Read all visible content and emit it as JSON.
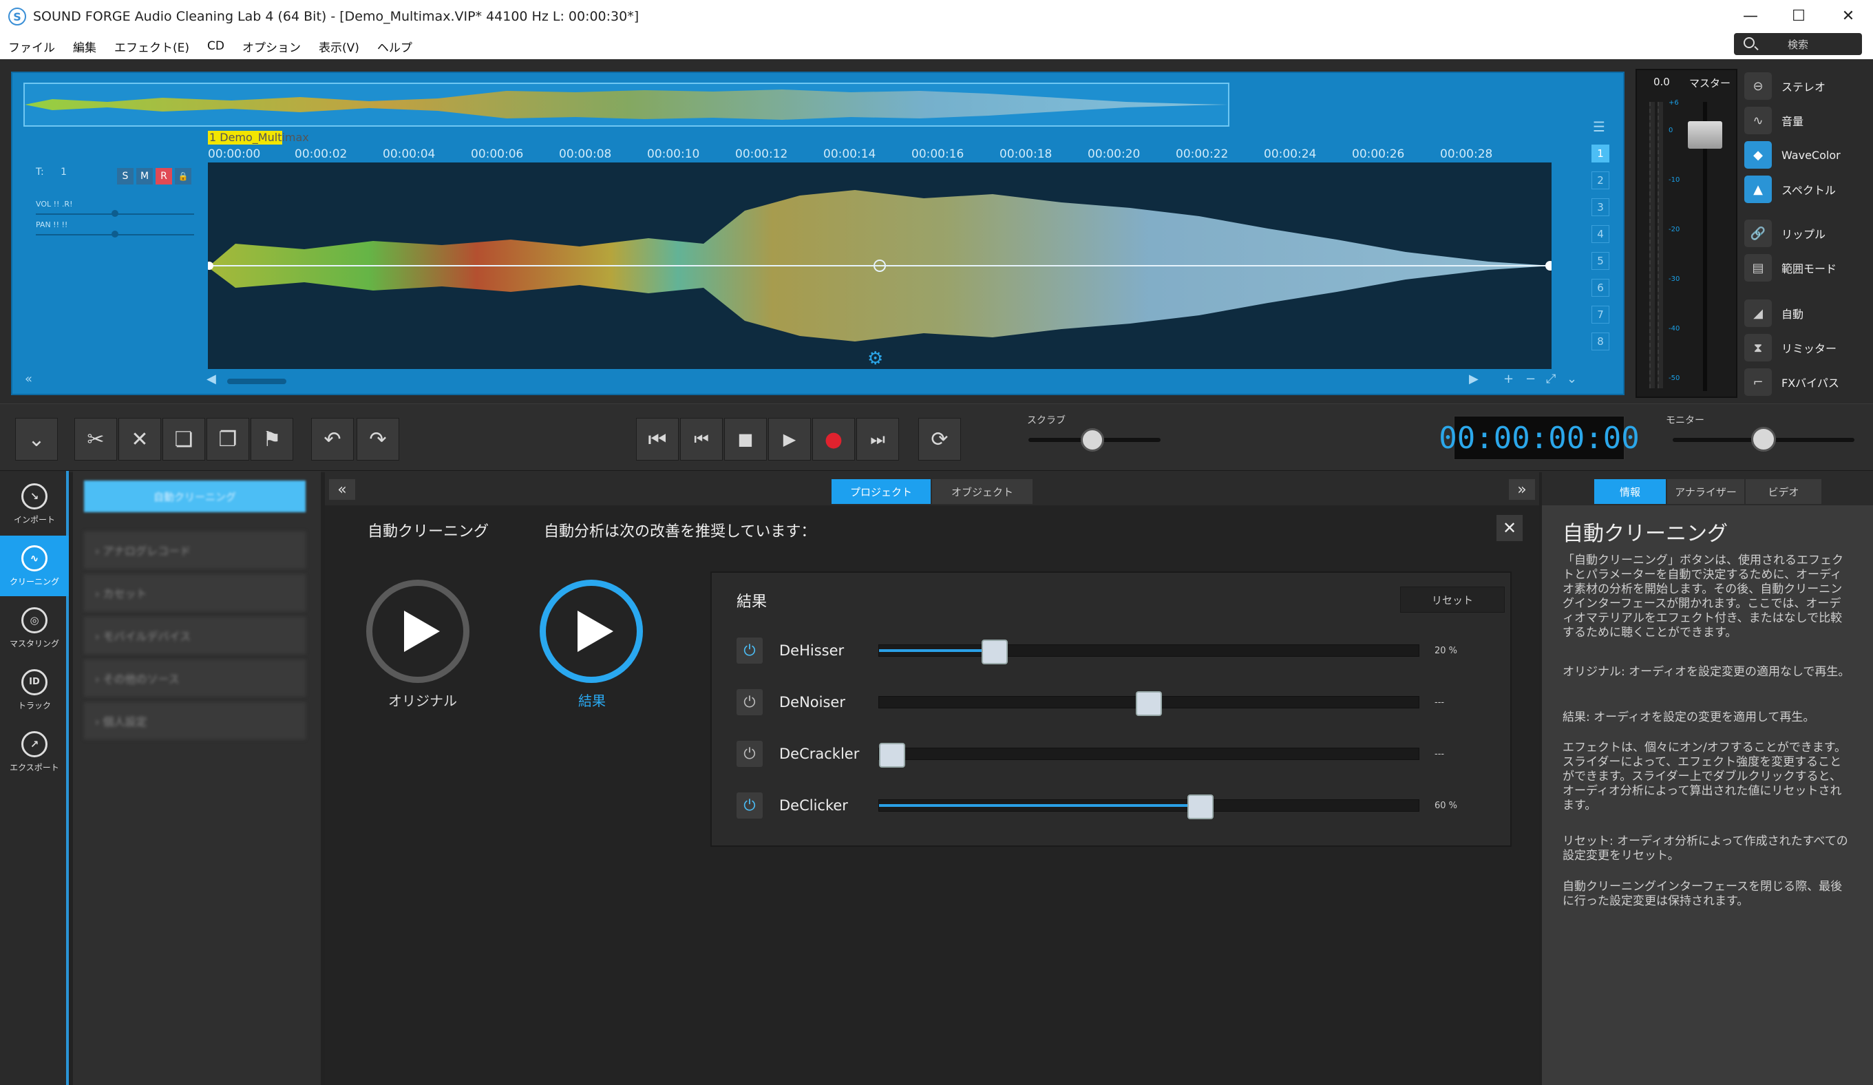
{
  "window": {
    "app_icon": "S",
    "title": "SOUND FORGE Audio Cleaning Lab 4 (64 Bit) - [Demo_Multimax.VIP*   44100 Hz L: 00:00:30*]",
    "minimize": "—",
    "maximize": "☐",
    "close": "✕"
  },
  "menu": [
    "ファイル",
    "編集",
    "エフェクト(E)",
    "CD",
    "オプション",
    "表示(V)",
    "ヘルプ"
  ],
  "search": {
    "placeholder": "検索"
  },
  "track": {
    "clip_label": "1 Demo_Multimax",
    "t_label": "T:",
    "t_value": "1",
    "buttons": [
      "S",
      "M",
      "R",
      "🔒"
    ],
    "vol_label": "VOL !!  .R!",
    "pan_label": "PAN !!  !!",
    "numbers": [
      "1",
      "2",
      "3",
      "4",
      "5",
      "6",
      "7",
      "8"
    ],
    "active_number": "1"
  },
  "ruler": [
    "00:00:00",
    "00:00:02",
    "00:00:04",
    "00:00:06",
    "00:00:08",
    "00:00:10",
    "00:00:12",
    "00:00:14",
    "00:00:16",
    "00:00:18",
    "00:00:20",
    "00:00:22",
    "00:00:24",
    "00:00:26",
    "00:00:28"
  ],
  "master": {
    "value": "0.0",
    "label": "マスター",
    "scale": [
      "+6",
      "0",
      "-10",
      "-20",
      "-30",
      "-40",
      "-50"
    ]
  },
  "right_buttons": [
    {
      "label": "ステレオ",
      "icon": "stereo-icon",
      "glyph": "⊖",
      "active": false
    },
    {
      "label": "音量",
      "icon": "volume-curve-icon",
      "glyph": "∿",
      "active": false
    },
    {
      "label": "WaveColor",
      "icon": "wavecolor-icon",
      "glyph": "◆",
      "active": true
    },
    {
      "label": "スペクトル",
      "icon": "spectrum-icon",
      "glyph": "▲",
      "active": true
    },
    {
      "label": "リップル",
      "icon": "ripple-icon",
      "glyph": "🔗",
      "active": false
    },
    {
      "label": "範囲モード",
      "icon": "range-mode-icon",
      "glyph": "▤",
      "active": false
    },
    {
      "label": "自動",
      "icon": "auto-icon",
      "glyph": "◢",
      "active": false
    },
    {
      "label": "リミッター",
      "icon": "limiter-icon",
      "glyph": "⧗",
      "active": false
    },
    {
      "label": "FXバイパス",
      "icon": "fx-bypass-icon",
      "glyph": "⌐",
      "active": false
    }
  ],
  "toolbar": {
    "scrub_label": "スクラブ",
    "monitor_label": "モニター",
    "timecode": "00:00:00:00",
    "glyphs": {
      "collapse": "⌄",
      "cut": "✂",
      "delete": "✕",
      "copy": "❏",
      "paste": "❐",
      "marker": "⚑",
      "undo": "↶",
      "redo": "↷",
      "to_start": "⏮",
      "prev": "⏮",
      "stop": "■",
      "play": "▶",
      "record": "●",
      "next": "⏭",
      "loop": "⟳"
    }
  },
  "leftnav": [
    {
      "label": "インポート",
      "icon": "import-icon",
      "glyph": "↘",
      "active": false
    },
    {
      "label": "クリーニング",
      "icon": "cleaning-icon",
      "glyph": "∿",
      "active": true
    },
    {
      "label": "マスタリング",
      "icon": "mastering-icon",
      "glyph": "◎",
      "active": false
    },
    {
      "label": "トラック",
      "icon": "track-id-icon",
      "glyph": "ID",
      "active": false
    },
    {
      "label": "エクスポート",
      "icon": "export-icon",
      "glyph": "↗",
      "active": false
    }
  ],
  "subnav": {
    "header": "自動クリーニング",
    "items": [
      "› アナログレコード",
      "› カセット",
      "› モバイルデバイス",
      "› その他のソース",
      "› 個人設定"
    ]
  },
  "center": {
    "left_arrow": "«",
    "right_arrow": "»",
    "tabs": [
      {
        "label": "プロジェクト",
        "active": true
      },
      {
        "label": "オブジェクト",
        "active": false
      }
    ],
    "heading_left": "自動クリーニング",
    "heading_right": "自動分析は次の改善を推奨しています：",
    "close": "✕",
    "original_label": "オリジナル",
    "result_label": "結果",
    "results_title": "結果",
    "reset_label": "リセット",
    "power_glyph": "⏻",
    "filters": [
      {
        "name": "DeHisser",
        "value": 20,
        "display": "20 %",
        "on": true
      },
      {
        "name": "DeNoiser",
        "value": 50,
        "display": "---",
        "on": false
      },
      {
        "name": "DeCrackler",
        "value": 0,
        "display": "---",
        "on": false
      },
      {
        "name": "DeClicker",
        "value": 60,
        "display": "60 %",
        "on": true
      }
    ]
  },
  "info": {
    "tabs": [
      {
        "label": "情報",
        "active": true
      },
      {
        "label": "アナライザー",
        "active": false
      },
      {
        "label": "ビデオ",
        "active": false
      }
    ],
    "title": "自動クリーニング",
    "p1": "「自動クリーニング」ボタンは、使用されるエフェクトとパラメーターを自動で決定するために、オーディオ素材の分析を開始します。その後、自動クリーニングインターフェースが開かれます。ここでは、オーディオマテリアルをエフェクト付き、またはなしで比較するために聴くことができます。",
    "p2": "オリジナル: オーディオを設定変更の適用なしで再生。",
    "p3": "結果: オーディオを設定の変更を適用して再生。",
    "p4": "エフェクトは、個々にオン/オフすることができます。スライダーによって、エフェクト強度を変更することができます。スライダー上でダブルクリックすると、オーディオ分析によって算出された値にリセットされます。",
    "p5": "リセット: オーディオ分析によって作成されたすべての設定変更をリセット。",
    "p6": "自動クリーニングインターフェースを閉じる際、最後に行った設定変更は保持されます。"
  },
  "colors": {
    "accent": "#2a94d6",
    "accent_light": "#4cbef5",
    "record": "#e0222e",
    "timecode": "#2ba7ea",
    "clip_label_bg": "#f2e500"
  }
}
